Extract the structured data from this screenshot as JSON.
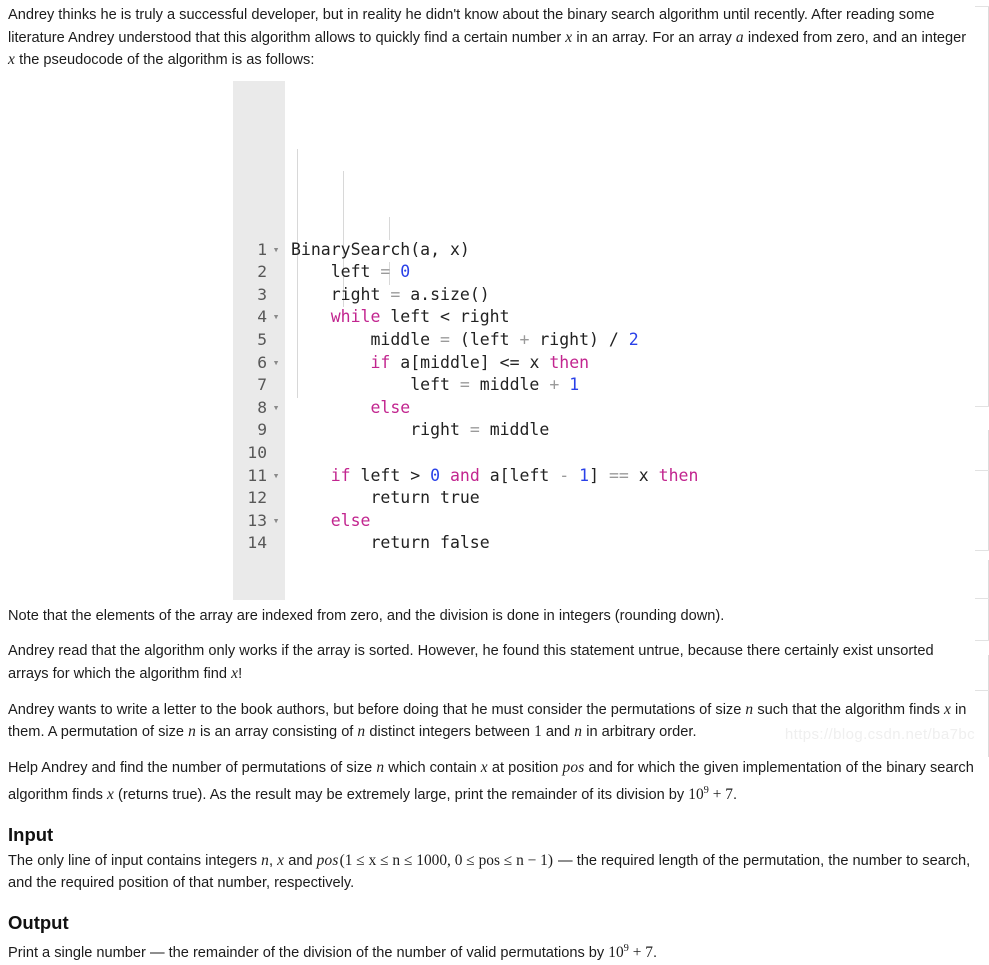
{
  "paragraphs": {
    "intro_1": "Andrey thinks he is truly a successful developer, but in reality he didn't know about the binary search algorithm until recently. After reading some literature Andrey understood that this algorithm allows to quickly find a certain number ",
    "intro_2": " in an array. For an array ",
    "intro_3": " indexed from zero, and an integer ",
    "intro_4": " the pseudocode of the algorithm is as follows:",
    "note": "Note that the elements of the array are indexed from zero, and the division is done in integers (rounding down).",
    "sorted_1": "Andrey read that the algorithm only works if the array is sorted. However, he found this statement untrue, because there certainly exist unsorted arrays for which the algorithm find ",
    "sorted_2": "!",
    "perm_1": "Andrey wants to write a letter to the book authors, but before doing that he must consider the permutations of size ",
    "perm_2": " such that the algorithm finds ",
    "perm_3": " in them. A permutation of size ",
    "perm_4": " is an array consisting of ",
    "perm_5": " distinct integers between ",
    "perm_6": " and ",
    "perm_7": " in arbitrary order.",
    "help_1": "Help Andrey and find the number of permutations of size ",
    "help_2": " which contain ",
    "help_3": " at position ",
    "help_4": " and for which the given implementation of the binary search algorithm finds ",
    "help_5": " (returns true). As the result may be extremely large, print the remainder of its division by ",
    "help_6": ".",
    "input_1": "The only line of input contains integers ",
    "input_2": ", ",
    "input_3": " and ",
    "input_4": " — the required length of the permutation, the number to search, and the required position of that number, respectively.",
    "output_1": "Print a single number — the remainder of the division of the number of valid permutations by ",
    "output_2": "."
  },
  "math": {
    "x": "x",
    "a": "a",
    "n": "n",
    "pos": "pos",
    "one": "1",
    "mod_base": "10",
    "mod_exp": "9",
    "mod_plus": " + 7",
    "constraint": "(1 ≤ x ≤ n ≤ 1000, 0 ≤ pos ≤ n − 1)"
  },
  "headings": {
    "input": "Input",
    "output": "Output"
  },
  "code": {
    "language": "pseudocode",
    "lines": [
      {
        "no": "1",
        "fold": "▾",
        "tokens": [
          {
            "t": "BinarySearch(a, x)",
            "c": "pl"
          }
        ]
      },
      {
        "no": "2",
        "fold": "",
        "tokens": [
          {
            "t": "    left ",
            "c": "pl"
          },
          {
            "t": "= ",
            "c": "op"
          },
          {
            "t": "0",
            "c": "num"
          }
        ]
      },
      {
        "no": "3",
        "fold": "",
        "tokens": [
          {
            "t": "    right ",
            "c": "pl"
          },
          {
            "t": "= ",
            "c": "op"
          },
          {
            "t": "a.size()",
            "c": "pl"
          }
        ]
      },
      {
        "no": "4",
        "fold": "▾",
        "tokens": [
          {
            "t": "    while",
            "c": "kw"
          },
          {
            "t": " left < right",
            "c": "pl"
          }
        ]
      },
      {
        "no": "5",
        "fold": "",
        "tokens": [
          {
            "t": "        middle ",
            "c": "pl"
          },
          {
            "t": "= ",
            "c": "op"
          },
          {
            "t": "(left ",
            "c": "pl"
          },
          {
            "t": "+ ",
            "c": "op"
          },
          {
            "t": "right) / ",
            "c": "pl"
          },
          {
            "t": "2",
            "c": "num"
          }
        ]
      },
      {
        "no": "6",
        "fold": "▾",
        "tokens": [
          {
            "t": "        ",
            "c": "pl"
          },
          {
            "t": "if",
            "c": "kw"
          },
          {
            "t": " a[middle] ",
            "c": "pl"
          },
          {
            "t": "<= ",
            "c": "pl"
          },
          {
            "t": "x ",
            "c": "pl"
          },
          {
            "t": "then",
            "c": "kw"
          }
        ]
      },
      {
        "no": "7",
        "fold": "",
        "tokens": [
          {
            "t": "            left ",
            "c": "pl"
          },
          {
            "t": "= ",
            "c": "op"
          },
          {
            "t": "middle ",
            "c": "pl"
          },
          {
            "t": "+ ",
            "c": "op"
          },
          {
            "t": "1",
            "c": "num"
          }
        ]
      },
      {
        "no": "8",
        "fold": "▾",
        "tokens": [
          {
            "t": "        ",
            "c": "pl"
          },
          {
            "t": "else",
            "c": "kw"
          }
        ]
      },
      {
        "no": "9",
        "fold": "",
        "tokens": [
          {
            "t": "            right ",
            "c": "pl"
          },
          {
            "t": "= ",
            "c": "op"
          },
          {
            "t": "middle",
            "c": "pl"
          }
        ]
      },
      {
        "no": "10",
        "fold": "",
        "tokens": [
          {
            "t": "",
            "c": "pl"
          }
        ]
      },
      {
        "no": "11",
        "fold": "▾",
        "tokens": [
          {
            "t": "    ",
            "c": "pl"
          },
          {
            "t": "if",
            "c": "kw"
          },
          {
            "t": " left > ",
            "c": "pl"
          },
          {
            "t": "0",
            "c": "num"
          },
          {
            "t": " ",
            "c": "pl"
          },
          {
            "t": "and",
            "c": "kw"
          },
          {
            "t": " a[left ",
            "c": "pl"
          },
          {
            "t": "- ",
            "c": "op"
          },
          {
            "t": "1",
            "c": "num"
          },
          {
            "t": "] ",
            "c": "pl"
          },
          {
            "t": "== ",
            "c": "op"
          },
          {
            "t": "x ",
            "c": "pl"
          },
          {
            "t": "then",
            "c": "kw"
          }
        ]
      },
      {
        "no": "12",
        "fold": "",
        "tokens": [
          {
            "t": "        return true",
            "c": "pl"
          }
        ]
      },
      {
        "no": "13",
        "fold": "▾",
        "tokens": [
          {
            "t": "    ",
            "c": "pl"
          },
          {
            "t": "else",
            "c": "kw"
          }
        ]
      },
      {
        "no": "14",
        "fold": "",
        "tokens": [
          {
            "t": "        return false",
            "c": "pl"
          }
        ]
      }
    ]
  },
  "watermark": "https://blog.csdn.net/ba7bc",
  "colors": {
    "keyword": "#c2258f",
    "number": "#2a41e8",
    "operator": "#9a9a9a",
    "text": "#222222",
    "gutter_bg": "#eaeaea",
    "page_bg": "#ffffff"
  }
}
